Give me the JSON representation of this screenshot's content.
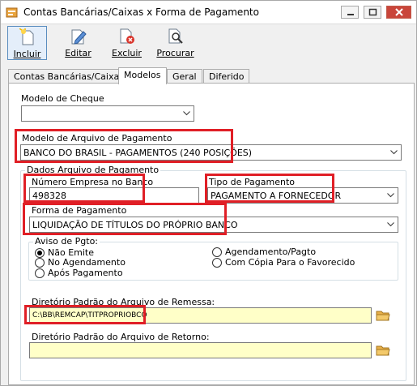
{
  "window": {
    "title": "Contas Bancárias/Caixas x Forma de Pagamento"
  },
  "toolbar": {
    "incluir": "Incluir",
    "editar": "Editar",
    "excluir": "Excluir",
    "procurar": "Procurar"
  },
  "tabs": [
    "Contas Bancárias/Caixas",
    "Modelos",
    "Geral",
    "Diferido"
  ],
  "form": {
    "modelo_cheque_label": "Modelo de Cheque",
    "modelo_cheque_value": "",
    "modelo_arquivo_label": "Modelo de Arquivo de Pagamento",
    "modelo_arquivo_value": "BANCO DO BRASIL - PAGAMENTOS (240 POSIÇÕES)",
    "dados_arquivo_title": "Dados Arquivo de Pagamento",
    "numero_empresa_label": "Número Empresa no Banco",
    "numero_empresa_value": "498328",
    "tipo_pagamento_label": "Tipo de Pagamento",
    "tipo_pagamento_value": "PAGAMENTO A FORNECEDOR",
    "forma_pagamento_label": "Forma de Pagamento",
    "forma_pagamento_value": "LIQUIDAÇÃO DE TÍTULOS DO PRÓPRIO BANCO",
    "aviso_title": "Aviso de Pgto:",
    "aviso_options": [
      "Não Emite",
      "No Agendamento",
      "Após Pagamento",
      "Agendamento/Pagto",
      "Com Cópia Para o Favorecido"
    ],
    "aviso_selected": "Não Emite",
    "dir_remessa_label": "Diretório Padrão do Arquivo de Remessa:",
    "dir_remessa_value": "C:\\BB\\REMCAP\\TITPROPRIOBCO",
    "dir_retorno_label": "Diretório Padrão do Arquivo de Retorno:",
    "dir_retorno_value": ""
  }
}
